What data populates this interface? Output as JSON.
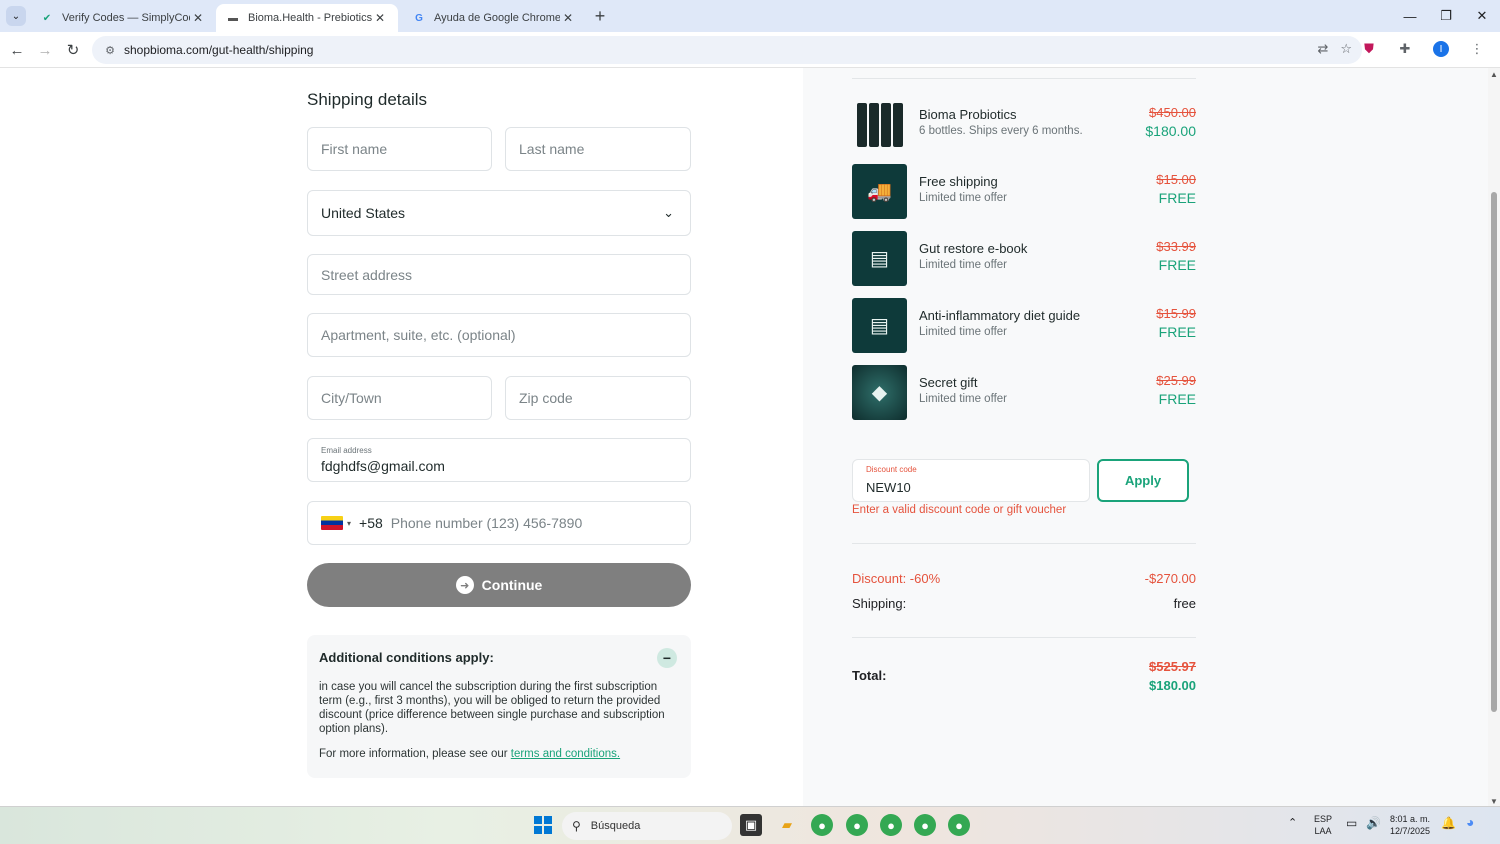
{
  "browser": {
    "tabs": [
      {
        "title": "Verify Codes — SimplyCodes",
        "icon": "simplycodes-icon",
        "active": false
      },
      {
        "title": "Bioma.Health - Prebiotics, Prob",
        "icon": "bioma-icon",
        "active": true
      },
      {
        "title": "Ayuda de Google Chrome",
        "icon": "google-icon",
        "active": false
      }
    ],
    "url": "shopbioma.com/gut-health/shipping"
  },
  "form": {
    "title": "Shipping details",
    "first_name_placeholder": "First name",
    "last_name_placeholder": "Last name",
    "country": "United States",
    "street_placeholder": "Street address",
    "apartment_placeholder": "Apartment, suite, etc. (optional)",
    "city_placeholder": "City/Town",
    "zip_placeholder": "Zip code",
    "email_label": "Email address",
    "email_value": "fdghdfs@gmail.com",
    "phone_code": "+58",
    "phone_placeholder": "Phone number (123) 456-7890",
    "continue_label": "Continue"
  },
  "conditions": {
    "title": "Additional conditions apply:",
    "body": "in case you will cancel the subscription during the first subscription term (e.g., first 3 months), you will be obliged to return the provided discount (price difference between single purchase and subscription option plans).",
    "more_prefix": "For more information, please see our ",
    "link": "terms and conditions."
  },
  "order": {
    "items": [
      {
        "name": "Bioma Probiotics",
        "sub": "6 bottles. Ships every 6 months.",
        "old": "$450.00",
        "new": "$180.00"
      },
      {
        "name": "Free shipping",
        "sub": "Limited time offer",
        "old": "$15.00",
        "new": "FREE"
      },
      {
        "name": "Gut restore e-book",
        "sub": "Limited time offer",
        "old": "$33.99",
        "new": "FREE"
      },
      {
        "name": "Anti-inflammatory diet guide",
        "sub": "Limited time offer",
        "old": "$15.99",
        "new": "FREE"
      },
      {
        "name": "Secret gift",
        "sub": "Limited time offer",
        "old": "$25.99",
        "new": "FREE"
      }
    ],
    "discount_label": "Discount code",
    "discount_value": "NEW10",
    "apply_label": "Apply",
    "error": "Enter a valid discount code or gift voucher",
    "discount_row_label": "Discount: -60%",
    "discount_row_value": "-$270.00",
    "shipping_label": "Shipping:",
    "shipping_value": "free",
    "total_label": "Total:",
    "total_old": "$525.97",
    "total_new": "$180.00"
  },
  "taskbar": {
    "search": "Búsqueda",
    "lang_top": "ESP",
    "lang_bottom": "LAA",
    "time": "8:01 a. m.",
    "date": "12/7/2025"
  }
}
